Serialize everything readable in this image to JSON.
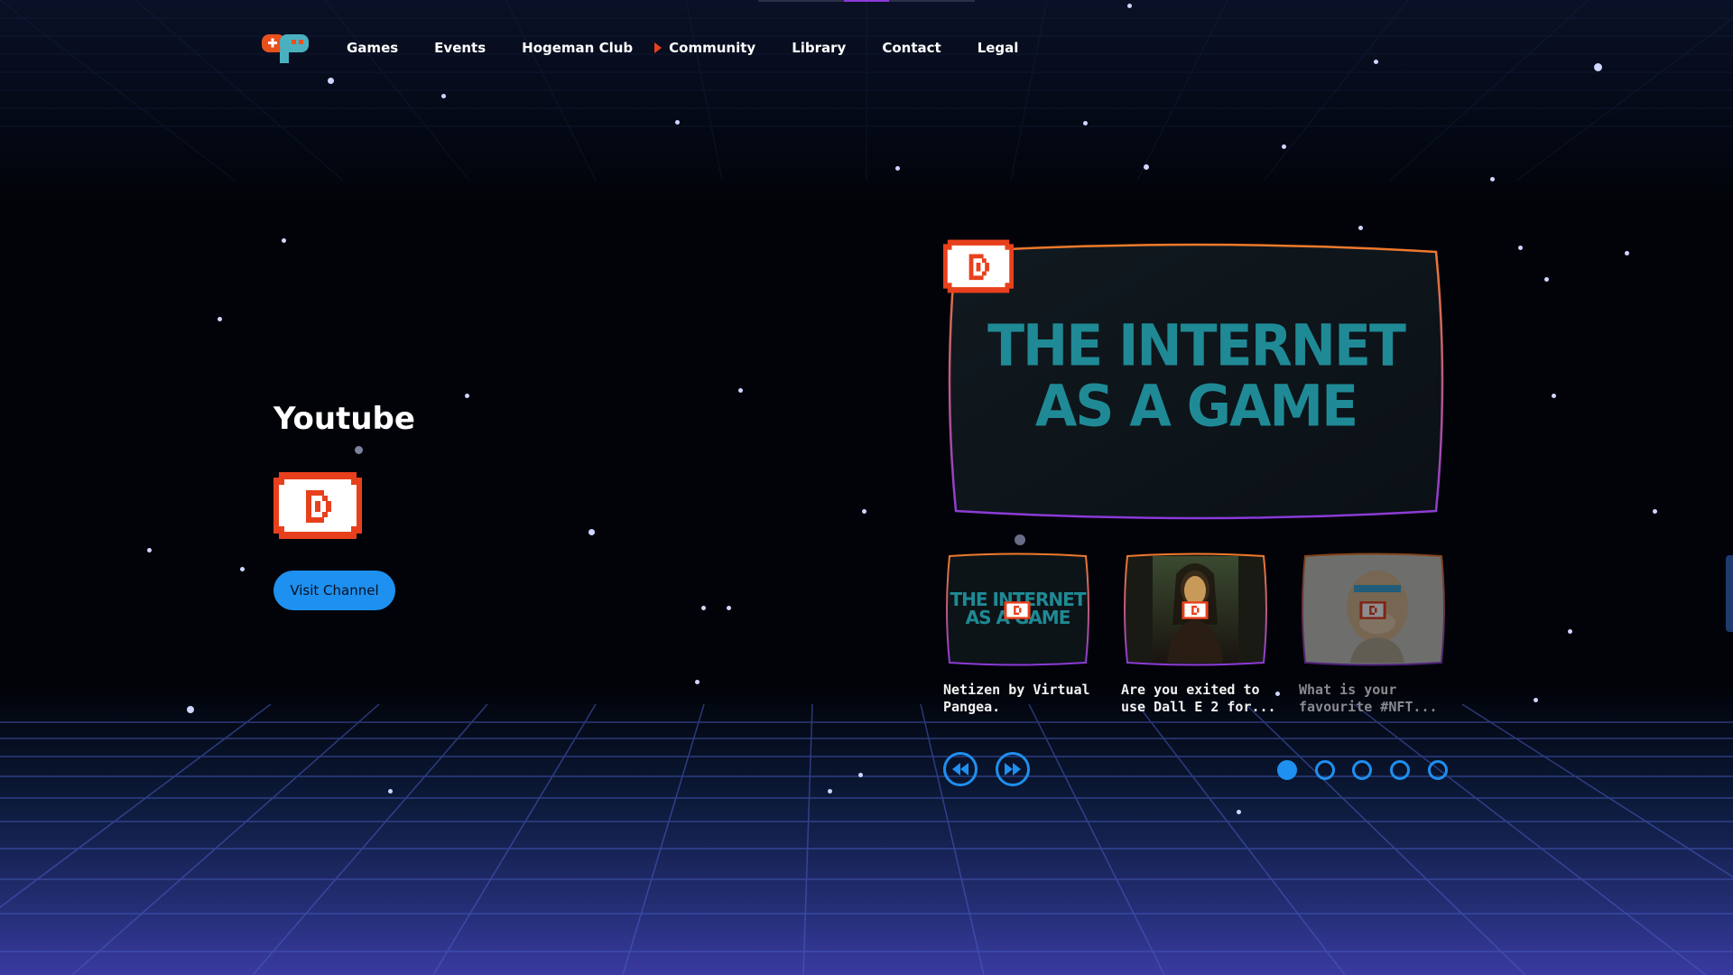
{
  "header": {
    "logo": "gamepad-logo",
    "nav": [
      {
        "label": "Games",
        "active": false
      },
      {
        "label": "Events",
        "active": false
      },
      {
        "label": "Hogeman Club",
        "active": false
      },
      {
        "label": "Community",
        "active": true
      },
      {
        "label": "Library",
        "active": false
      },
      {
        "label": "Contact",
        "active": false
      },
      {
        "label": "Legal",
        "active": false
      }
    ]
  },
  "channel": {
    "title": "Youtube",
    "icon": "youtube-pixel-icon",
    "button_label": "Visit Channel"
  },
  "featured": {
    "image_text_line1": "THE INTERNET",
    "image_text_line2": "AS A GAME",
    "play_icon": "play-icon"
  },
  "thumbnails": [
    {
      "image_text_line1": "THE INTERNET",
      "image_text_line2": "AS A GAME",
      "caption": "Netizen by Virtual Pangea."
    },
    {
      "caption": "Are you exited to use Dall E 2 for..."
    },
    {
      "caption": "What is your favourite #NFT..."
    }
  ],
  "controls": {
    "prev_icon": "rewind-icon",
    "next_icon": "fast-forward-icon",
    "page_count": 5,
    "active_page": 1
  },
  "colors": {
    "accent_blue": "#1e90f0",
    "accent_orange": "#e8401c",
    "frame_orange": "#f07a2a",
    "frame_purple": "#8a3ad8",
    "teal_text": "#1f8a95"
  }
}
